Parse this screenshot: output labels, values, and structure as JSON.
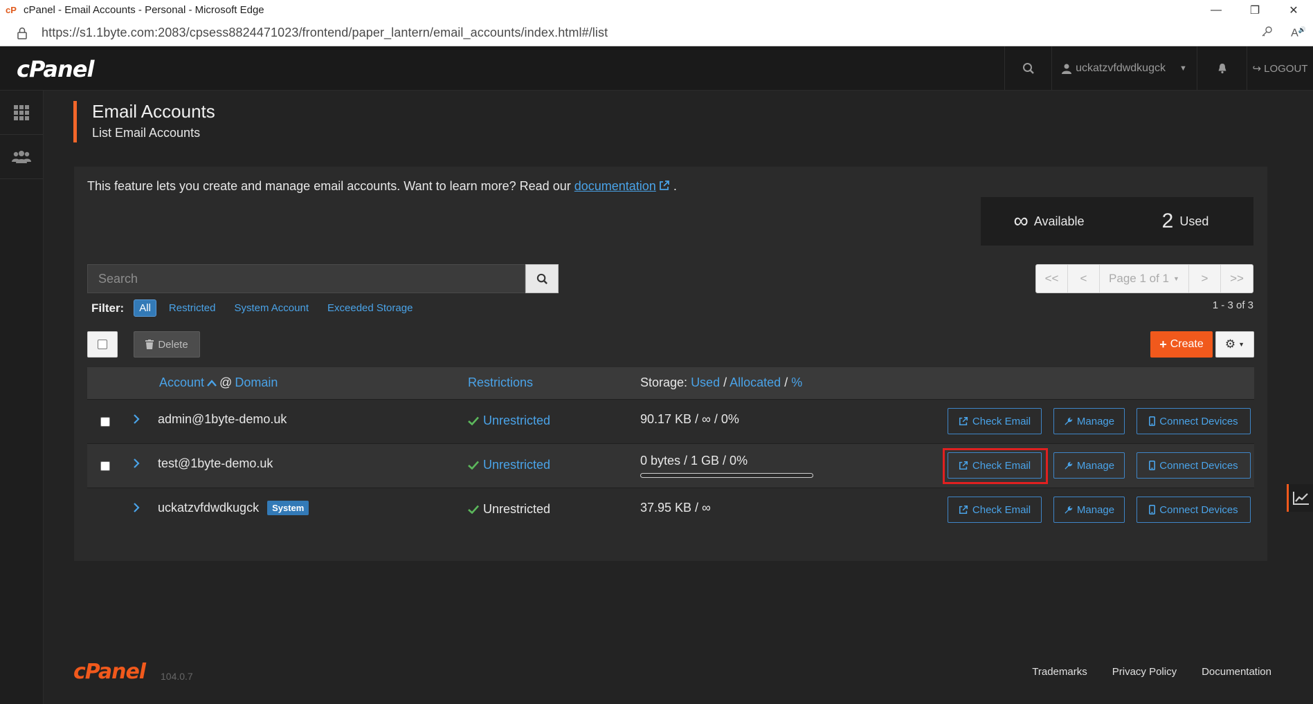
{
  "browser": {
    "title": "cPanel - Email Accounts - Personal - Microsoft Edge",
    "url": "https://s1.1byte.com:2083/cpsess8824471023/frontend/paper_lantern/email_accounts/index.html#/list"
  },
  "topnav": {
    "logo": "cPanel",
    "username": "uckatzvfdwdkugck",
    "logout": "LOGOUT"
  },
  "header": {
    "title": "Email Accounts",
    "subtitle": "List Email Accounts"
  },
  "intro": {
    "text": "This feature lets you create and manage email accounts. Want to learn more? Read our ",
    "link": "documentation",
    "suffix": "."
  },
  "stats": {
    "available_value": "∞",
    "available_label": "Available",
    "used_value": "2",
    "used_label": "Used"
  },
  "search": {
    "placeholder": "Search"
  },
  "pager": {
    "first": "<<",
    "prev": "<",
    "page": "Page 1 of 1",
    "next": ">",
    "last": ">>",
    "range": "1 - 3 of 3"
  },
  "filter": {
    "label": "Filter:",
    "options": [
      "All",
      "Restricted",
      "System Account",
      "Exceeded Storage"
    ],
    "selected": "All"
  },
  "toolbar": {
    "delete": "Delete",
    "create": "Create"
  },
  "table": {
    "headers": {
      "account": "Account",
      "at": "@",
      "domain": "Domain",
      "restrictions": "Restrictions",
      "storage": "Storage:",
      "used": "Used",
      "sep1": "/",
      "allocated": "Allocated",
      "sep2": "/",
      "percent": "%"
    },
    "rows": [
      {
        "account": "admin@1byte-demo.uk",
        "badge": "",
        "restriction": "Unrestricted",
        "storage": "90.17 KB / ∞ / 0%",
        "usage_fraction": null
      },
      {
        "account": "test@1byte-demo.uk",
        "badge": "",
        "restriction": "Unrestricted",
        "storage": "0 bytes / 1 GB / 0%",
        "usage_fraction": 0
      },
      {
        "account": "uckatzvfdwdkugck",
        "badge": "System",
        "restriction": "Unrestricted",
        "storage": "37.95 KB / ∞",
        "usage_fraction": null
      }
    ],
    "actions": {
      "check_email": "Check Email",
      "manage": "Manage",
      "connect": "Connect Devices"
    }
  },
  "footer": {
    "logo": "cPanel",
    "version": "104.0.7",
    "links": [
      "Trademarks",
      "Privacy Policy",
      "Documentation"
    ]
  },
  "colors": {
    "accent": "#f1591c",
    "link": "#4aa3e8",
    "highlight": "#e02020",
    "success": "#5cb85c"
  }
}
